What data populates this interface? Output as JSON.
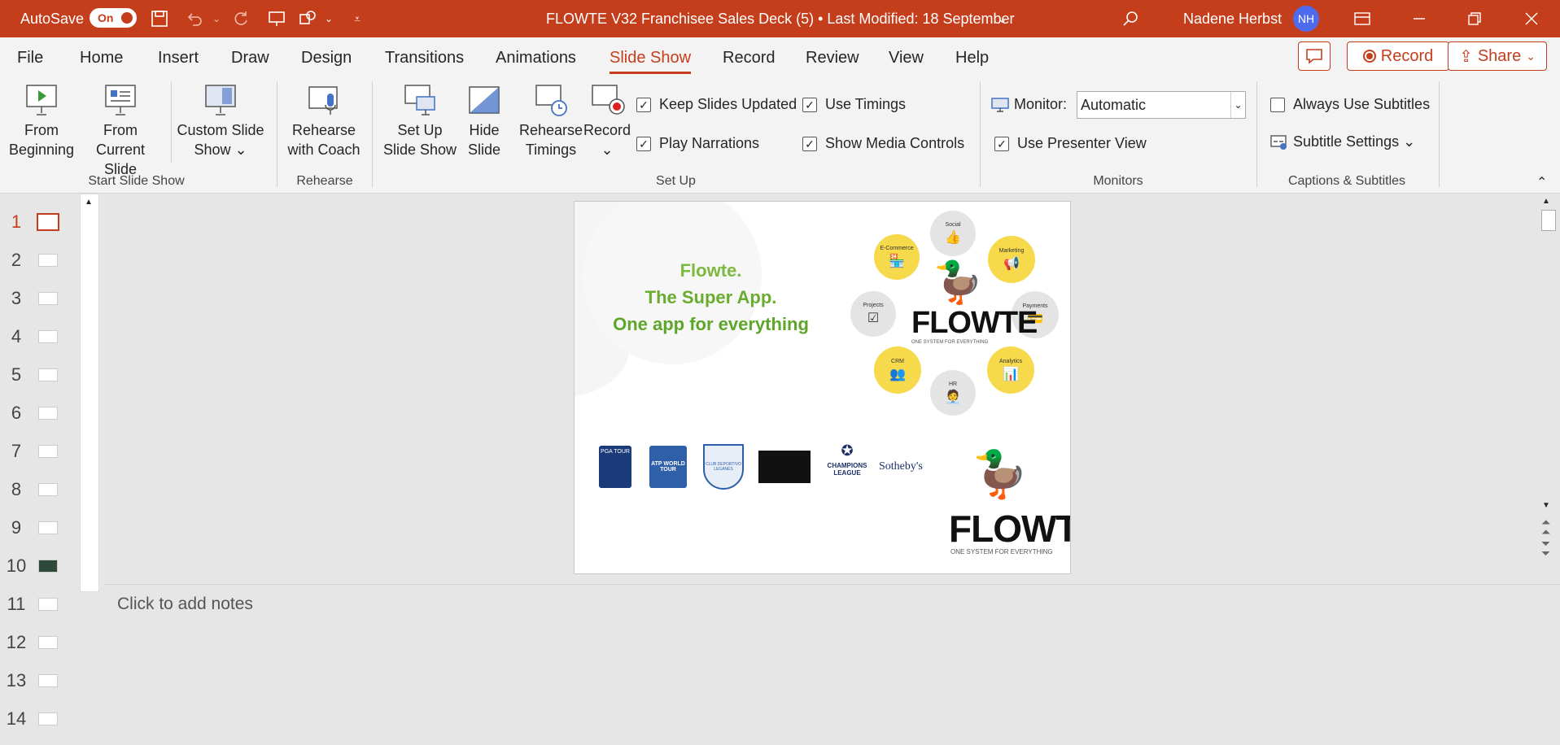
{
  "titlebar": {
    "autosave_label": "AutoSave",
    "autosave_state": "On",
    "document_title": "FLOWTE V32 Franchisee Sales Deck (5) • Last Modified: 18 September",
    "user_name": "Nadene Herbst",
    "user_initials": "NH"
  },
  "menu": {
    "tabs": [
      "File",
      "Home",
      "Insert",
      "Draw",
      "Design",
      "Transitions",
      "Animations",
      "Slide Show",
      "Record",
      "Review",
      "View",
      "Help"
    ],
    "active_tab": "Slide Show",
    "record_button": "Record",
    "share_button": "Share"
  },
  "ribbon": {
    "start_group": {
      "label": "Start Slide Show",
      "from_beginning": [
        "From",
        "Beginning"
      ],
      "from_current": [
        "From",
        "Current Slide"
      ],
      "custom_show": [
        "Custom Slide",
        "Show ⌄"
      ]
    },
    "rehearse_group": {
      "label": "Rehearse",
      "rehearse_coach": [
        "Rehearse",
        "with Coach"
      ]
    },
    "setup_group": {
      "label": "Set Up",
      "setup_show": [
        "Set Up",
        "Slide Show"
      ],
      "hide_slide": [
        "Hide",
        "Slide"
      ],
      "rehearse_timings": [
        "Rehearse",
        "Timings"
      ],
      "record": [
        "Record",
        "⌄"
      ],
      "keep_updated": "Keep Slides Updated",
      "play_narrations": "Play Narrations",
      "use_timings": "Use Timings",
      "show_media_controls": "Show Media Controls"
    },
    "monitors_group": {
      "label": "Monitors",
      "monitor_label": "Monitor:",
      "monitor_value": "Automatic",
      "use_presenter_view": "Use Presenter View"
    },
    "captions_group": {
      "label": "Captions & Subtitles",
      "always_subtitles": "Always Use Subtitles",
      "subtitle_settings": "Subtitle Settings ⌄"
    }
  },
  "slides": {
    "numbers": [
      "1",
      "2",
      "3",
      "4",
      "5",
      "6",
      "7",
      "8",
      "9",
      "10",
      "11",
      "12",
      "13",
      "14"
    ],
    "active": "1"
  },
  "slide": {
    "line1": "Flowte.",
    "line2": "The Super App.",
    "line3": "One app for everything",
    "brand": "FLOWTE",
    "brand_tagline": "ONE SYSTEM FOR EVERYTHING",
    "circles": [
      "Social",
      "Marketing",
      "Payments",
      "Analytics",
      "HR",
      "CRM",
      "Projects",
      "E-Commerce"
    ],
    "logos": [
      "PGA TOUR",
      "ATP WORLD TOUR",
      "CLUB DEPORTIVO LEGANÉS",
      "",
      "CHAMPIONS LEAGUE",
      "Sotheby's"
    ]
  },
  "notes": {
    "placeholder": "Click to add notes"
  }
}
